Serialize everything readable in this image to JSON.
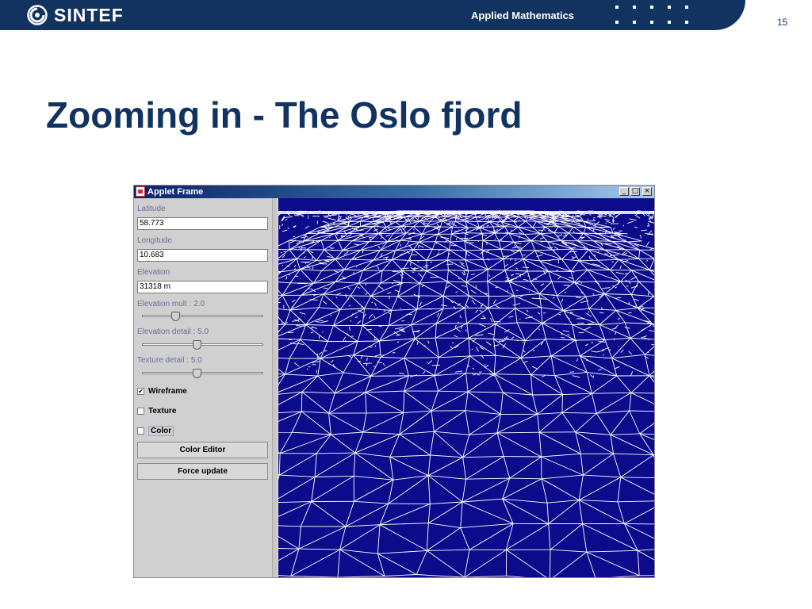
{
  "header": {
    "logo_text": "SINTEF",
    "department": "Applied Mathematics",
    "page_number": "15",
    "band_color": "#12335f"
  },
  "slide": {
    "title": "Zooming in - The Oslo fjord"
  },
  "applet": {
    "window_title": "Applet Frame",
    "window_buttons": [
      "_",
      "□",
      "×"
    ],
    "fields": {
      "latitude": {
        "label": "Latitude",
        "value": "58.773"
      },
      "longitude": {
        "label": "Longitude",
        "value": "10.683"
      },
      "elevation": {
        "label": "Elevation",
        "value": "31318 m"
      }
    },
    "sliders": {
      "elevation_mult": {
        "label": "Elevation mult : 2.0"
      },
      "elevation_detail": {
        "label": "Elevation detail : 5.0"
      },
      "texture_detail": {
        "label": "Texture detail : 5.0"
      }
    },
    "checkboxes": {
      "wireframe": {
        "label": "Wireframe",
        "checked": true
      },
      "texture": {
        "label": "Texture",
        "checked": false
      },
      "color": {
        "label": "Color",
        "checked": false
      }
    },
    "buttons": {
      "color_editor": "Color Editor",
      "force_update": "Force update"
    },
    "viewport": {
      "background": "#0b0b8c",
      "wire_color": "#ffffff",
      "mode": "wireframe terrain mesh"
    }
  }
}
